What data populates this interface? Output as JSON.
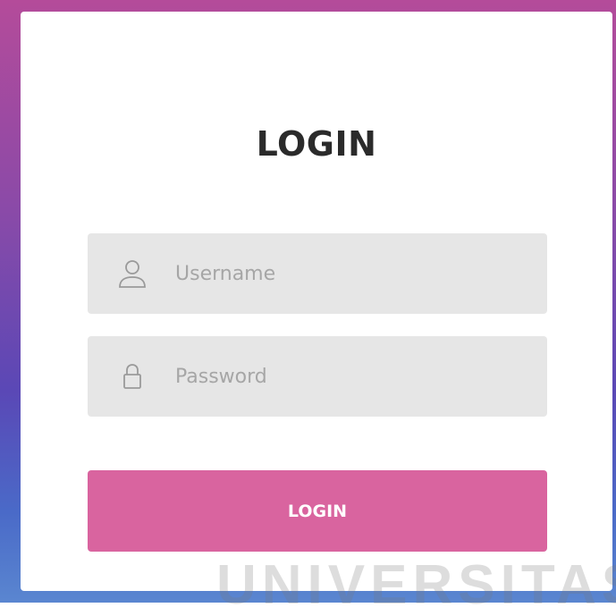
{
  "login_form": {
    "title": "LOGIN",
    "username": {
      "placeholder": "Username",
      "value": "",
      "icon": "user-icon"
    },
    "password": {
      "placeholder": "Password",
      "value": "",
      "icon": "lock-icon"
    },
    "submit_label": "LOGIN"
  },
  "background": {
    "watermark_text": "UNIVERSITAS",
    "gradient_colors": [
      "#b44b9a",
      "#8a4aa8",
      "#5a48b6",
      "#4a6ac8",
      "#5a86d0"
    ]
  },
  "colors": {
    "accent": "#d9649f",
    "field_bg": "#e6e6e6",
    "title": "#2b2b2b",
    "placeholder": "#a6a6a6"
  }
}
